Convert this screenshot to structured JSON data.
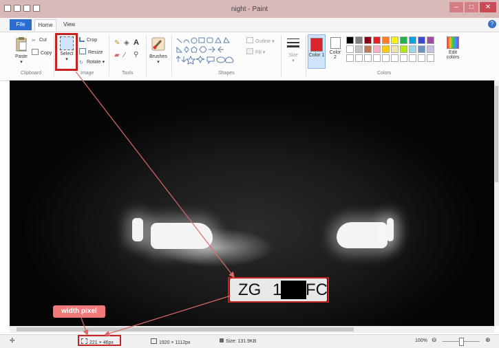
{
  "window": {
    "title": "night - Paint",
    "controls": [
      "–",
      "□",
      "✕"
    ]
  },
  "ribbon_tabs": {
    "file": "File",
    "home": "Home",
    "view": "View"
  },
  "clipboard": {
    "paste": "Paste",
    "cut": "Cut",
    "copy": "Copy",
    "group": "Clipboard"
  },
  "image": {
    "select": "Select",
    "crop": "Crop",
    "resize": "Resize",
    "rotate": "Rotate",
    "group": "Image"
  },
  "tools": {
    "group": "Tools",
    "text_tool": "A"
  },
  "brushes": {
    "label": "Brushes"
  },
  "shapes": {
    "outline": "Outline",
    "fill": "Fill",
    "group": "Shapes"
  },
  "size": {
    "label": "Size"
  },
  "colors": {
    "color1_label": "Color 1",
    "color2_label": "Color 2",
    "edit_colors_label": "Edit colors",
    "group": "Colors",
    "color1": "#d9262c",
    "color2": "#ffffff",
    "palette_row1": [
      "#000000",
      "#7f7f7f",
      "#880015",
      "#ed1c24",
      "#ff7f27",
      "#fff200",
      "#22b14c",
      "#00a2e8",
      "#3f48cc",
      "#a349a4"
    ],
    "palette_row2": [
      "#ffffff",
      "#c3c3c3",
      "#b97a57",
      "#ffaec9",
      "#ffc90e",
      "#efe4b0",
      "#b5e61d",
      "#99d9ea",
      "#7092be",
      "#c8bfe7"
    ]
  },
  "canvas": {
    "plate_text": [
      "ZG",
      "1",
      "FC"
    ]
  },
  "annotation": {
    "label": "width pixel"
  },
  "status": {
    "selection_size": "221 × 46px",
    "image_size": "1920 × 1112px",
    "file_size": "Size: 131.9KB",
    "zoom": "100%"
  }
}
